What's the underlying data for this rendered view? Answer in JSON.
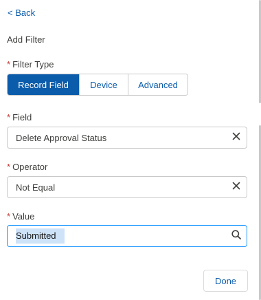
{
  "nav": {
    "back_label": "< Back"
  },
  "panel": {
    "title": "Add Filter"
  },
  "filter_type": {
    "required_mark": "*",
    "label": "Filter Type",
    "options": [
      "Record Field",
      "Device",
      "Advanced"
    ],
    "selected": "Record Field"
  },
  "field": {
    "required_mark": "*",
    "label": "Field",
    "value": "Delete Approval Status",
    "clear_icon": "close-icon"
  },
  "operator": {
    "required_mark": "*",
    "label": "Operator",
    "value": "Not Equal",
    "clear_icon": "close-icon"
  },
  "value_field": {
    "required_mark": "*",
    "label": "Value",
    "value": "Submitted",
    "search_icon": "search-icon"
  },
  "actions": {
    "done_label": "Done"
  },
  "colors": {
    "brand": "#0b5cab",
    "required": "#c23934",
    "border": "#c9c9c9",
    "text": "#3e3e3c",
    "selection": "#cfe3f8"
  }
}
